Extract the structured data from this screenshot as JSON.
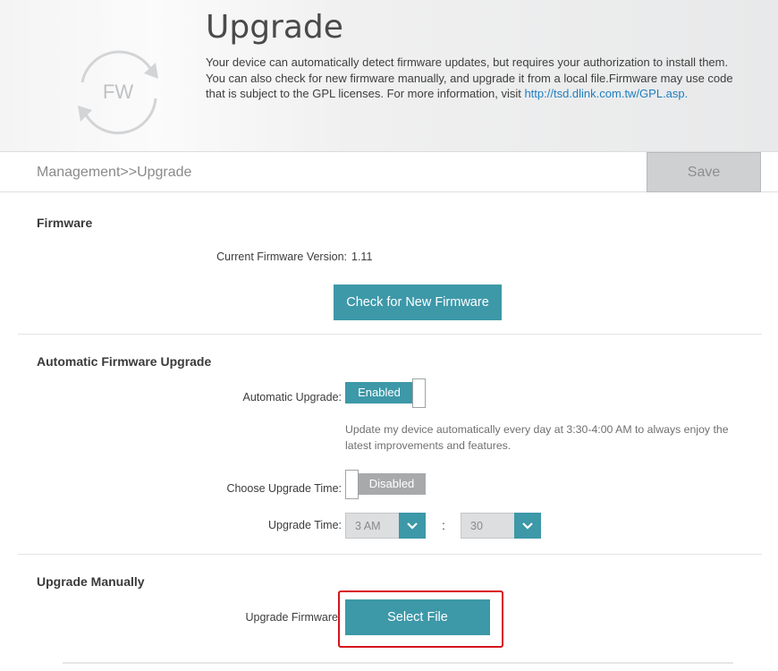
{
  "header": {
    "logo_text": "FW",
    "title": "Upgrade",
    "description": "Your device can automatically detect firmware updates, but requires your authorization to install them. You can also check for new firmware manually, and upgrade it from a local file.Firmware may use code that is subject to the GPL licenses. For more information, visit ",
    "link_text": "http://tsd.dlink.com.tw/GPL.asp."
  },
  "breadcrumb": "Management>>Upgrade",
  "toolbar": {
    "save_label": "Save"
  },
  "firmware": {
    "title": "Firmware",
    "version_label": "Current Firmware Version:",
    "version_value": "1.11",
    "check_button": "Check for New Firmware"
  },
  "auto_upgrade": {
    "title": "Automatic Firmware Upgrade",
    "auto_label": "Automatic Upgrade:",
    "auto_state": "Enabled",
    "hint": "Update my device automatically every day at 3:30-4:00 AM to always enjoy the latest improvements and features.",
    "choose_time_label": "Choose Upgrade Time:",
    "choose_time_state": "Disabled",
    "time_label": "Upgrade Time:",
    "hour_value": "3 AM",
    "separator": ":",
    "minute_value": "30"
  },
  "manual": {
    "title": "Upgrade Manually",
    "upgrade_label": "Upgrade Firmware",
    "select_button": "Select File"
  },
  "colors": {
    "accent": "#3d98a8",
    "disabled_toggle": "#a7a9ab",
    "highlight": "#d6141d",
    "link": "#1d7fc2"
  }
}
